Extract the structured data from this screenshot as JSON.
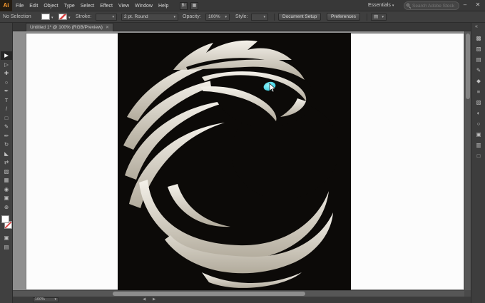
{
  "ui": {
    "caret": "▾",
    "double_chevron": "«"
  },
  "colors": {
    "eye_cyan": "#35d8ea",
    "plumage_light": "#f2efe8",
    "plumage_dark": "#b5ae9f",
    "none_red": "#d84040",
    "canvas_black": "#0c0a08"
  },
  "titlebar": {
    "logo": "Ai",
    "bridge_label": "Br",
    "arrange_icon": "▦",
    "workspace": "Essentials",
    "search_placeholder": "Search Adobe Stock",
    "minimize": "–",
    "close": "✕"
  },
  "menubar": {
    "items": [
      "File",
      "Edit",
      "Object",
      "Type",
      "Select",
      "Effect",
      "View",
      "Window",
      "Help"
    ]
  },
  "controlbar": {
    "selection_status": "No Selection",
    "stroke_label": "Stroke:",
    "brush_value": "2 pt. Round",
    "opacity_label": "Opacity:",
    "opacity_value": "100%",
    "style_label": "Style:",
    "document_setup": "Document Setup",
    "preferences": "Preferences",
    "arrange_icon": "▤"
  },
  "tabbar": {
    "title": "Untitled 1* @ 100% (RGB/Preview)",
    "close": "✕"
  },
  "tools": [
    {
      "name": "selection-tool",
      "glyph": "▶"
    },
    {
      "name": "direct-selection-tool",
      "glyph": "▷"
    },
    {
      "name": "magic-wand-tool",
      "glyph": "✚"
    },
    {
      "name": "lasso-tool",
      "glyph": "○"
    },
    {
      "name": "pen-tool",
      "glyph": "✒"
    },
    {
      "name": "type-tool",
      "glyph": "T"
    },
    {
      "name": "line-segment-tool",
      "glyph": "/"
    },
    {
      "name": "rectangle-tool",
      "glyph": "□"
    },
    {
      "name": "paintbrush-tool",
      "glyph": "✎"
    },
    {
      "name": "pencil-tool",
      "glyph": "✏"
    },
    {
      "name": "rotate-tool",
      "glyph": "↻"
    },
    {
      "name": "scale-tool",
      "glyph": "◣"
    },
    {
      "name": "width-tool",
      "glyph": "⇄"
    },
    {
      "name": "gradient-tool",
      "glyph": "▧"
    },
    {
      "name": "mesh-tool",
      "glyph": "▦"
    },
    {
      "name": "eyedropper-tool",
      "glyph": "◉"
    },
    {
      "name": "artboard-tool",
      "glyph": "▣"
    },
    {
      "name": "zoom-tool",
      "glyph": "⊕"
    }
  ],
  "panel_icons": [
    {
      "name": "color-panel",
      "glyph": "▩"
    },
    {
      "name": "color-guide-panel",
      "glyph": "▧"
    },
    {
      "name": "swatches-panel",
      "glyph": "▤"
    },
    {
      "name": "brushes-panel",
      "glyph": "✎"
    },
    {
      "name": "symbols-panel",
      "glyph": "◆"
    },
    {
      "name": "stroke-panel",
      "glyph": "≡"
    },
    {
      "name": "gradient-panel",
      "glyph": "▨"
    },
    {
      "name": "transparency-panel",
      "glyph": "◐"
    },
    {
      "name": "appearance-panel",
      "glyph": "○"
    },
    {
      "name": "graphic-styles-panel",
      "glyph": "▣"
    },
    {
      "name": "layers-panel",
      "glyph": "▥"
    },
    {
      "name": "artboards-panel",
      "glyph": "□"
    }
  ],
  "statusbar": {
    "zoom": "100%",
    "prev": "◀",
    "next": "▶"
  },
  "artwork": {
    "description": "Stylized eagle head logo of curved cream stripes on black with cyan eye"
  }
}
